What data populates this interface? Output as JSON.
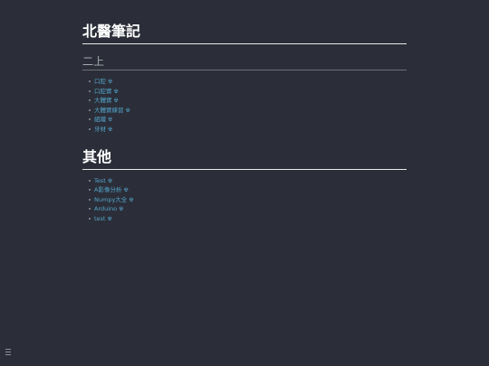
{
  "title": "北醫筆記",
  "section1": {
    "heading": "二上",
    "items": [
      {
        "label": "口腔",
        "mark": "☢"
      },
      {
        "label": "口腔實",
        "mark": "☢"
      },
      {
        "label": "大體實",
        "mark": "☢"
      },
      {
        "label": "大體實練習",
        "mark": "☢"
      },
      {
        "label": "組織",
        "mark": "☢"
      },
      {
        "label": "牙材",
        "mark": "☢"
      }
    ]
  },
  "section2": {
    "heading": "其他",
    "items": [
      {
        "label": "Test",
        "mark": "☢"
      },
      {
        "label": "A影像分析",
        "mark": "☢"
      },
      {
        "label": "Numpy大全",
        "mark": "☢"
      },
      {
        "label": "Arduino",
        "mark": "☢"
      },
      {
        "label": "test",
        "mark": "☢"
      }
    ]
  },
  "colors": {
    "background": "#2b2e38",
    "link": "#53a3c9",
    "heading": "#ffffff",
    "subheading": "#a6a9b0"
  },
  "icons": {
    "item_mark": "radioactive-icon",
    "menu": "menu-icon"
  }
}
